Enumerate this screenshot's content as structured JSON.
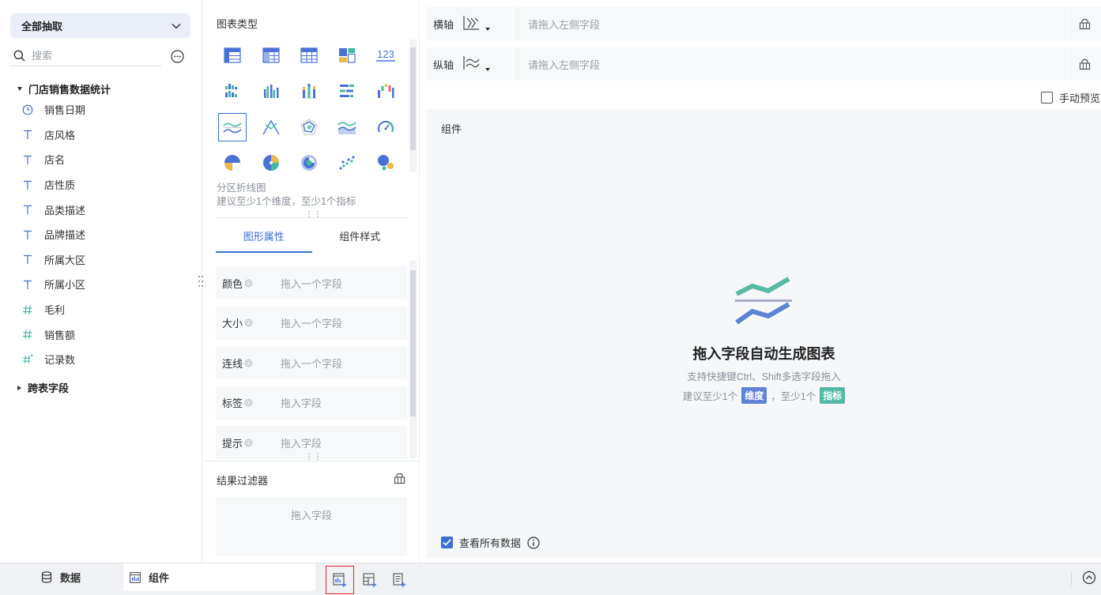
{
  "left_panel": {
    "scope_select": "全部抽取",
    "search": {
      "placeholder": "搜索"
    },
    "dataset": {
      "name": "门店销售数据统计"
    },
    "fields": [
      {
        "label": "销售日期",
        "type": "date"
      },
      {
        "label": "店风格",
        "type": "text"
      },
      {
        "label": "店名",
        "type": "text"
      },
      {
        "label": "店性质",
        "type": "text"
      },
      {
        "label": "品类描述",
        "type": "text"
      },
      {
        "label": "品牌描述",
        "type": "text"
      },
      {
        "label": "所属大区",
        "type": "text"
      },
      {
        "label": "所属小区",
        "type": "text"
      },
      {
        "label": "毛利",
        "type": "number"
      },
      {
        "label": "销售额",
        "type": "number"
      },
      {
        "label": "记录数",
        "type": "count"
      }
    ],
    "cross_table": {
      "name": "跨表字段"
    }
  },
  "middle_panel": {
    "chart_type_title": "图表类型",
    "chart_types": [
      "table-icon",
      "crosstab-icon",
      "detail-table-icon",
      "treemap-icon",
      "kpi-number-icon",
      "grouped-bar-icon",
      "column-icon",
      "stacked-column-icon",
      "horizontal-bar-icon",
      "waterfall-icon",
      "area-line-icon",
      "radar-line-icon",
      "radar-icon",
      "area-icon",
      "gauge-icon",
      "pie-icon",
      "multi-pie-icon",
      "donut-icon",
      "scatter-icon",
      "bubble-icon"
    ],
    "selected_chart_index": 10,
    "chart_desc": {
      "name": "分区折线图",
      "hint": "建议至少1个维度，至少1个指标"
    },
    "tabs": {
      "shape": "图形属性",
      "style": "组件样式"
    },
    "properties": [
      {
        "label": "颜色",
        "drop": "拖入一个字段"
      },
      {
        "label": "大小",
        "drop": "拖入一个字段"
      },
      {
        "label": "连线",
        "drop": "拖入一个字段"
      },
      {
        "label": "标签",
        "drop": "拖入字段"
      },
      {
        "label": "提示",
        "drop": "拖入字段"
      }
    ],
    "filter": {
      "title": "结果过滤器",
      "drop": "拖入字段"
    }
  },
  "right_panel": {
    "x_axis": {
      "label": "横轴",
      "drop": "请拖入左侧字段"
    },
    "y_axis": {
      "label": "纵轴",
      "drop": "请拖入左侧字段"
    },
    "manual_preview": "手动预览",
    "canvas": {
      "title": "组件",
      "empty_title": "拖入字段自动生成图表",
      "empty_tip": "支持快捷键Ctrl、Shift多选字段拖入",
      "suggest_prefix": "建议至少1个",
      "dimension_tag": "维度",
      "suggest_mid": "，至少1个",
      "measure_tag": "指标",
      "view_all": "查看所有数据"
    }
  },
  "bottom_bar": {
    "tab_data": "数据",
    "tab_component": "组件"
  },
  "colors": {
    "accent": "#3b6fd4",
    "dimension": "#5d82d6",
    "measure": "#55b9a7",
    "teal_icon": "#45b8a5",
    "highlight_border": "#e02b2b"
  }
}
